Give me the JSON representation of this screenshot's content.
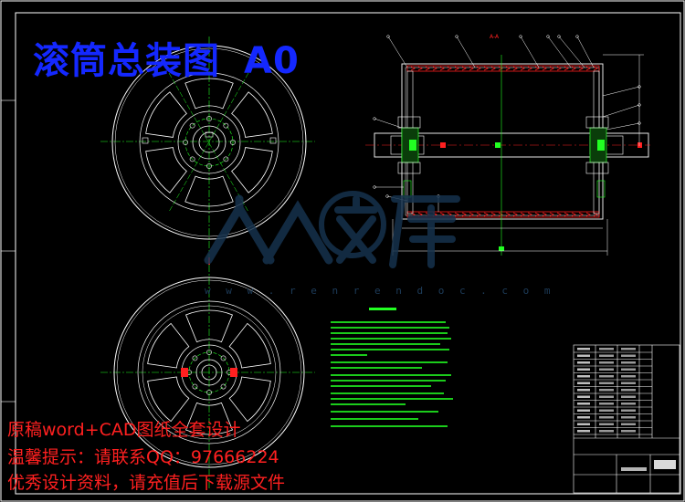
{
  "title": {
    "name": "滚筒总装图",
    "code": "A0"
  },
  "ads": {
    "line1": "原稿word+CAD图纸全套设计",
    "line2": "温馨提示：请联系QQ：97666224",
    "line3": "优秀设计资料，请充值后下载源文件"
  },
  "watermark": {
    "brand": "人人文库",
    "url": "w w w . r e n r e n d o c . c o m"
  },
  "section_mark": "A-A",
  "colors": {
    "background": "#000000",
    "lines": "#ffffff",
    "centerlines": "#22ff22",
    "title": "#1428ff",
    "ads": "#ff2020",
    "hatch": "#ff2020"
  }
}
